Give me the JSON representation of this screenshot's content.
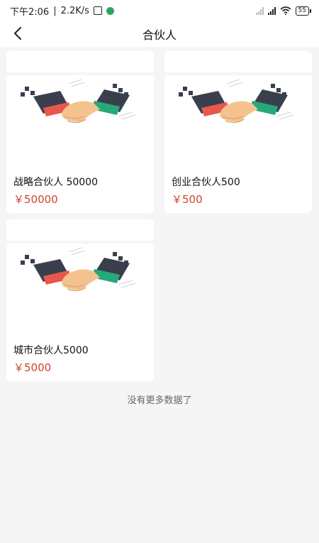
{
  "status": {
    "time": "下午2:06",
    "speed": "2.2K/s",
    "battery": "55"
  },
  "nav": {
    "title": "合伙人"
  },
  "products": [
    {
      "title": "战略合伙人 50000",
      "price": "￥50000"
    },
    {
      "title": "创业合伙人500",
      "price": "￥500"
    },
    {
      "title": "城市合伙人5000",
      "price": "￥5000"
    }
  ],
  "footer": {
    "note": "没有更多数据了"
  },
  "colors": {
    "price": "#d0432b",
    "accent_red": "#e8584a",
    "accent_green": "#27a879",
    "sleeve_dark": "#3a3f4e",
    "skin": "#f4c28f"
  },
  "icons": {
    "back": "chevron-left-icon",
    "wifi": "wifi-icon",
    "battery": "battery-icon",
    "signal": "signal-icon",
    "handshake": "handshake-icon"
  }
}
